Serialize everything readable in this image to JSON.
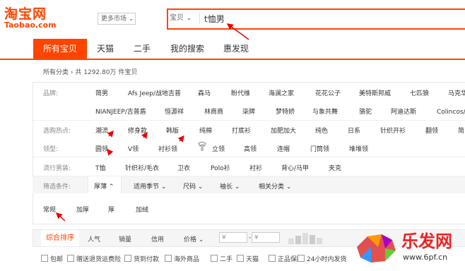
{
  "header": {
    "logo_cn": "淘宝网",
    "logo_en": "Taobao.com",
    "market": "更多市场",
    "market_icon": "chevron-down-icon",
    "search_category": "宝贝",
    "search_value": "t恤男"
  },
  "nav": {
    "tabs": [
      "所有宝贝",
      "天猫",
      "二手",
      "我的搜索",
      "惠发现"
    ]
  },
  "breadcrumb": {
    "root": "所有分类",
    "arrow": "›",
    "count": "共 1292.80万 件宝贝"
  },
  "filters": {
    "brand_label": "品牌:",
    "brand_row1": [
      "简男",
      "Afs Jeep/战地吉普",
      "森马",
      "盼代维",
      "海澜之家",
      "花花公子",
      "美特斯邦威",
      "七匹狼",
      "马克华"
    ],
    "brand_row2": [
      "NIANJEEP/吉普盾",
      "恒源祥",
      "林商商",
      "柒牌",
      "梦特娇",
      "与象共舞",
      "骆驼",
      "阿迪达斯",
      "Colincos/卡"
    ],
    "hot_label": "选购热点:",
    "hot": [
      "潮流",
      "修身款",
      "韩版",
      "纯棉",
      "打底衫",
      "加肥加大",
      "纯色",
      "日系",
      "针织开衫",
      "翻领",
      "简"
    ],
    "collar_label": "领型:",
    "collar": [
      "圆领",
      "V领",
      "衬衫领",
      "立领",
      "高领",
      "连帽",
      "门筒领",
      "堆堆领"
    ],
    "style_label": "流行男装:",
    "style": [
      "T恤",
      "针织衫/毛衣",
      "卫衣",
      "Polo衫",
      "衬衫",
      "背心/马甲",
      "夹克"
    ],
    "cond_label": "筛选条件:",
    "cond": [
      "厚薄",
      "适用季节",
      "尺码",
      "袖长",
      "相关分类"
    ],
    "sub": [
      "常规",
      "加厚",
      "厚",
      "加绒"
    ]
  },
  "sort": {
    "items": [
      "综合排序",
      "人气",
      "销量",
      "信用",
      "价格"
    ],
    "price_placeholder": "¥",
    "dash": "-"
  },
  "checks": [
    "包邮",
    "赠送退货运费险",
    "货到付款",
    "海外商品",
    "二手",
    "天猫",
    "正品保障",
    "24小时内发货"
  ],
  "watermark": {
    "text": "乐发网",
    "url": "www.6pf.cn"
  }
}
